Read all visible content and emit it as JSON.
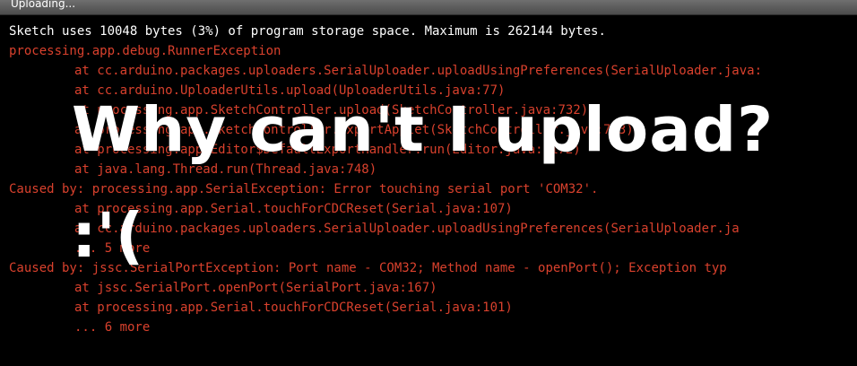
{
  "window": {
    "title": "Uploading..."
  },
  "console": {
    "lines": [
      "Sketch uses 10048 bytes (3%) of program storage space. Maximum is 262144 bytes.",
      "processing.app.debug.RunnerException",
      "at cc.arduino.packages.uploaders.SerialUploader.uploadUsingPreferences(SerialUploader.java:",
      "at cc.arduino.UploaderUtils.upload(UploaderUtils.java:77)",
      "at processing.app.SketchController.upload(SketchController.java:732)",
      "at processing.app.SketchController.exportApplet(SketchController.java:703)",
      "at processing.app.Editor$DefaultExportHandler.run(Editor.java:2172)",
      "at java.lang.Thread.run(Thread.java:748)",
      "Caused by: processing.app.SerialException: Error touching serial port 'COM32'.",
      "at processing.app.Serial.touchForCDCReset(Serial.java:107)",
      "at cc.arduino.packages.uploaders.SerialUploader.uploadUsingPreferences(SerialUploader.ja",
      "... 5 more",
      "Caused by: jssc.SerialPortException: Port name - COM32; Method name - openPort(); Exception typ",
      "at jssc.SerialPort.openPort(SerialPort.java:167)",
      "at processing.app.Serial.touchForCDCReset(Serial.java:101)",
      "... 6 more"
    ]
  },
  "overlay": {
    "line1": "Why can't I upload?",
    "line2": ":'("
  },
  "colors": {
    "error_text": "#d9412d",
    "info_text": "#ffffff",
    "background": "#000000",
    "titlebar": "#5a5a5a"
  }
}
